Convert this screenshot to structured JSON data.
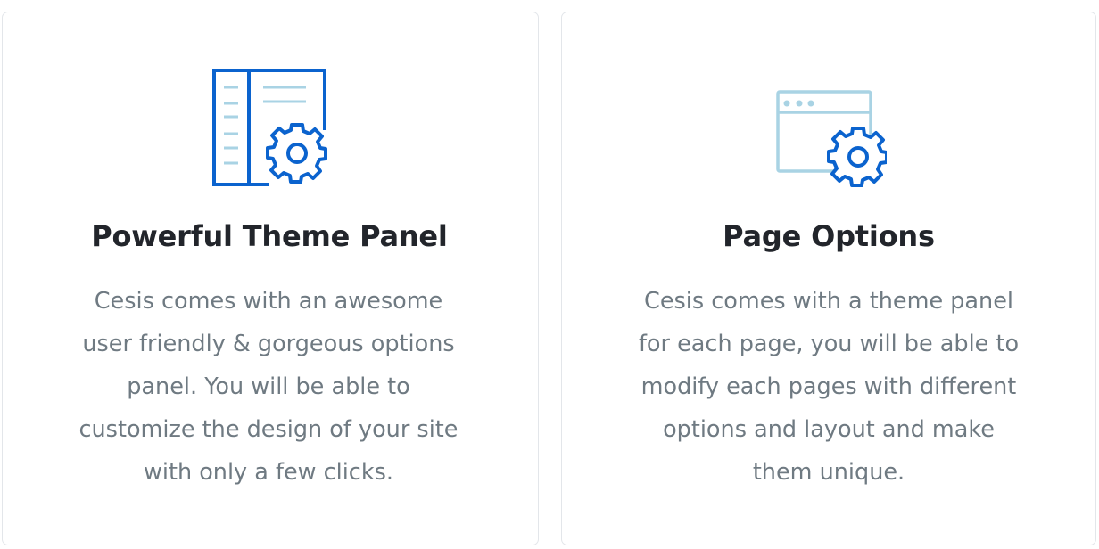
{
  "colors": {
    "accent_blue": "#0b63ce",
    "light_blue": "#a9d3e4",
    "title": "#22252b",
    "body": "#6f7a82",
    "border": "#e3e6ea"
  },
  "features": [
    {
      "icon": "theme-panel-gear-icon",
      "title": "Powerful Theme Panel",
      "description_lines": [
        "Cesis comes with an awesome",
        "user friendly & gorgeous options",
        "panel. You will be able to",
        "customize the design of your site",
        "with only a few clicks."
      ]
    },
    {
      "icon": "browser-window-gear-icon",
      "title": "Page Options",
      "description_lines": [
        "Cesis comes with a theme panel",
        "for each page, you will be able to",
        "modify each pages with different",
        "options and layout and make",
        "them unique."
      ]
    }
  ]
}
